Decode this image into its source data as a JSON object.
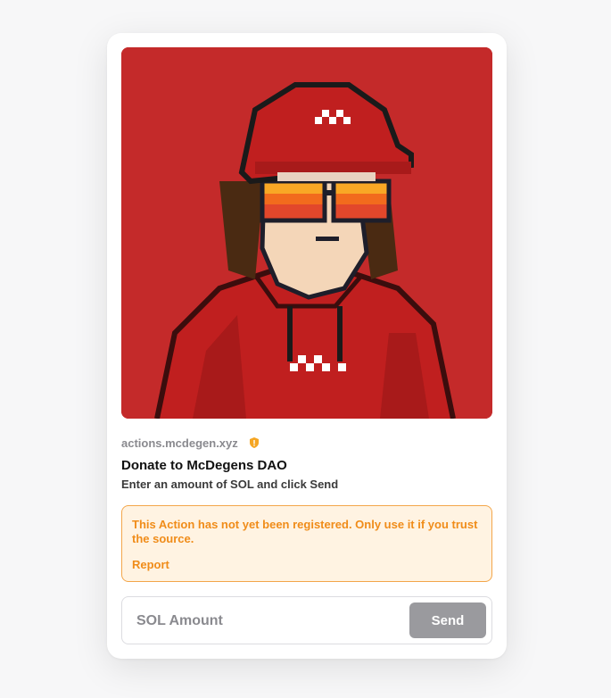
{
  "card": {
    "domain": "actions.mcdegen.xyz",
    "title": "Donate to McDegens DAO",
    "description": "Enter an amount of SOL and click Send",
    "image_icon": "pixel-art-avatar-red-hoodie",
    "warning_icon": "shield-warning-icon"
  },
  "alert": {
    "message": "This Action has not yet been registered. Only use it if you trust the source.",
    "link_label": "Report"
  },
  "form": {
    "amount_placeholder": "SOL Amount",
    "amount_value": "",
    "send_label": "Send"
  },
  "colors": {
    "background": "#f7f7f8",
    "card": "#ffffff",
    "image_bg": "#c42a2a",
    "warning": "#f08c19",
    "warning_bg": "#fff3e2",
    "button_disabled": "#9a9a9e"
  }
}
